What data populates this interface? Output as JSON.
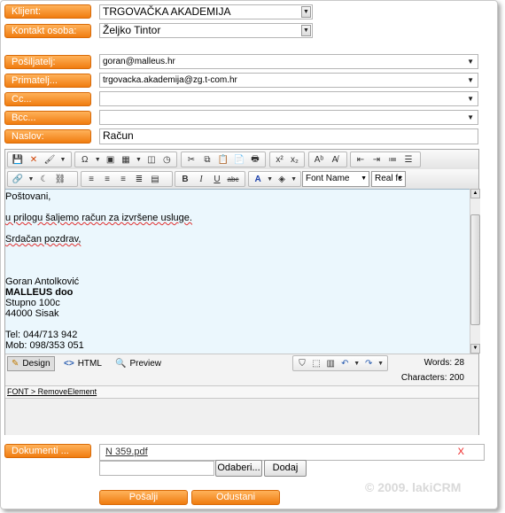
{
  "labels": {
    "klijent": "Klijent:",
    "kontakt": "Kontakt osoba:",
    "posiljatelj": "Pošiljatelj:",
    "primatelj": "Primatelj...",
    "cc": "Cc...",
    "bcc": "Bcc...",
    "naslov": "Naslov:",
    "dokumenti": "Dokumenti ..."
  },
  "fields": {
    "klijent": "TRGOVAČKA AKADEMIJA",
    "kontakt": "Željko Tintor",
    "posiljatelj": "goran@malleus.hr",
    "primatelj": "trgovacka.akademija@zg.t-com.hr",
    "cc": "",
    "bcc": "",
    "naslov": "Račun"
  },
  "toolbar": {
    "font_name": "Font Name",
    "font_size": "Real fc"
  },
  "body_lines": [
    "Poštovani,",
    "",
    "u prilogu šaljemo račun za izvršene usluge.",
    "",
    "Srdačan pozdrav,",
    "",
    "",
    "",
    "Goran Antolković",
    "MALLEUS doo",
    "Stupno 100c",
    "44000 Sisak",
    "",
    "Tel: 044/713 942",
    "Mob: 098/353 051"
  ],
  "modes": {
    "design": "Design",
    "html": "HTML",
    "preview": "Preview"
  },
  "stats": {
    "words": "Words: 28",
    "characters": "Characters: 200"
  },
  "path": "FONT > RemoveElement",
  "attachment": {
    "file": "N 359.pdf",
    "remove": "X"
  },
  "buttons": {
    "browse": "Odaberi...",
    "add": "Dodaj",
    "send": "Pošalji",
    "cancel": "Odustani"
  },
  "watermark": "© 2009. lakiCRM",
  "colors": {
    "accent": "#f39a3a",
    "editor_bg": "#ebf7fd"
  }
}
